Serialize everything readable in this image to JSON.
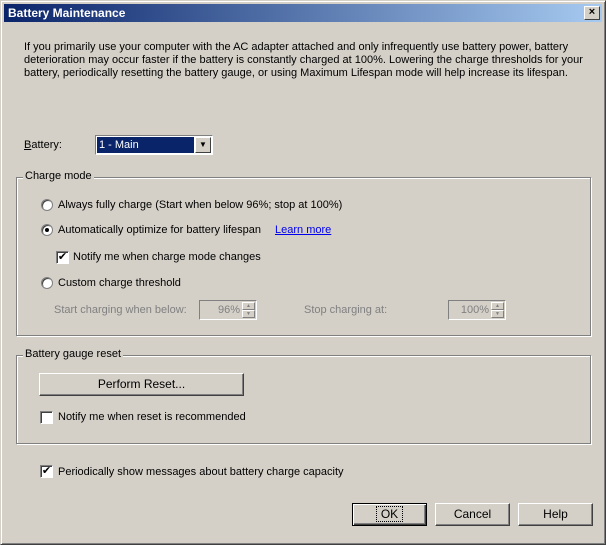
{
  "window": {
    "title": "Battery Maintenance",
    "close_label": "×"
  },
  "intro_text": "If you primarily use your computer with the AC adapter attached and only infrequently use battery power, battery deterioration may occur faster if the battery is constantly charged at 100%. Lowering the charge thresholds for your battery, periodically resetting the battery gauge, or using Maximum Lifespan mode will help increase its lifespan.",
  "battery": {
    "label_prefix": "B",
    "label_rest": "attery:",
    "selected": "1 - Main",
    "arrow": "▼"
  },
  "charge_mode": {
    "group_label": "Charge mode",
    "options": [
      {
        "label": "Always fully charge (Start when below 96%; stop at 100%)",
        "selected": false
      },
      {
        "label": "Automatically optimize for battery lifespan",
        "selected": true
      },
      {
        "label": "Custom charge threshold",
        "selected": false
      }
    ],
    "learn_more": "Learn more",
    "notify_label": "Notify me when charge mode changes",
    "notify_checked": true,
    "start_label": "Start charging when below:",
    "start_value": "96%",
    "stop_label": "Stop charging at:",
    "stop_value": "100%"
  },
  "gauge_reset": {
    "group_label": "Battery gauge reset",
    "perform_button": "Perform Reset...",
    "notify_label": "Notify me when reset is recommended",
    "notify_checked": false
  },
  "periodic": {
    "label": "Periodically show messages about battery charge capacity",
    "checked": true
  },
  "buttons": {
    "ok": "OK",
    "cancel": "Cancel",
    "help": "Help"
  }
}
